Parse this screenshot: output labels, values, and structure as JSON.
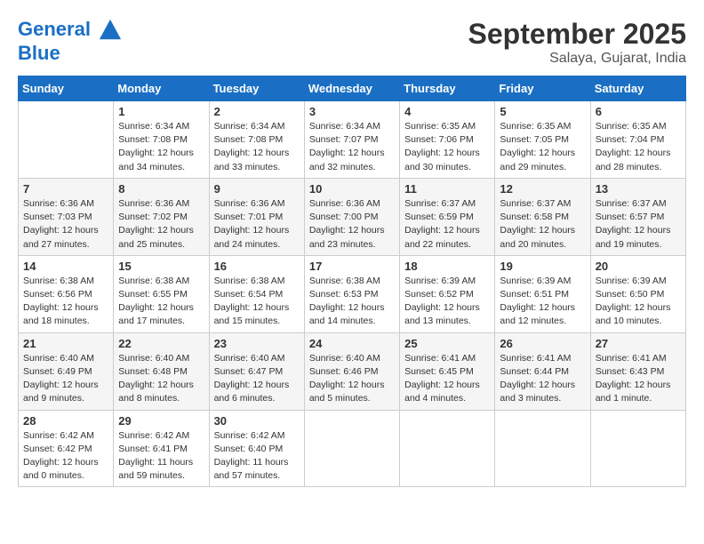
{
  "header": {
    "logo_line1": "General",
    "logo_line2": "Blue",
    "month": "September 2025",
    "location": "Salaya, Gujarat, India"
  },
  "days_of_week": [
    "Sunday",
    "Monday",
    "Tuesday",
    "Wednesday",
    "Thursday",
    "Friday",
    "Saturday"
  ],
  "weeks": [
    [
      {
        "day": "",
        "info": ""
      },
      {
        "day": "1",
        "info": "Sunrise: 6:34 AM\nSunset: 7:08 PM\nDaylight: 12 hours\nand 34 minutes."
      },
      {
        "day": "2",
        "info": "Sunrise: 6:34 AM\nSunset: 7:08 PM\nDaylight: 12 hours\nand 33 minutes."
      },
      {
        "day": "3",
        "info": "Sunrise: 6:34 AM\nSunset: 7:07 PM\nDaylight: 12 hours\nand 32 minutes."
      },
      {
        "day": "4",
        "info": "Sunrise: 6:35 AM\nSunset: 7:06 PM\nDaylight: 12 hours\nand 30 minutes."
      },
      {
        "day": "5",
        "info": "Sunrise: 6:35 AM\nSunset: 7:05 PM\nDaylight: 12 hours\nand 29 minutes."
      },
      {
        "day": "6",
        "info": "Sunrise: 6:35 AM\nSunset: 7:04 PM\nDaylight: 12 hours\nand 28 minutes."
      }
    ],
    [
      {
        "day": "7",
        "info": "Sunrise: 6:36 AM\nSunset: 7:03 PM\nDaylight: 12 hours\nand 27 minutes."
      },
      {
        "day": "8",
        "info": "Sunrise: 6:36 AM\nSunset: 7:02 PM\nDaylight: 12 hours\nand 25 minutes."
      },
      {
        "day": "9",
        "info": "Sunrise: 6:36 AM\nSunset: 7:01 PM\nDaylight: 12 hours\nand 24 minutes."
      },
      {
        "day": "10",
        "info": "Sunrise: 6:36 AM\nSunset: 7:00 PM\nDaylight: 12 hours\nand 23 minutes."
      },
      {
        "day": "11",
        "info": "Sunrise: 6:37 AM\nSunset: 6:59 PM\nDaylight: 12 hours\nand 22 minutes."
      },
      {
        "day": "12",
        "info": "Sunrise: 6:37 AM\nSunset: 6:58 PM\nDaylight: 12 hours\nand 20 minutes."
      },
      {
        "day": "13",
        "info": "Sunrise: 6:37 AM\nSunset: 6:57 PM\nDaylight: 12 hours\nand 19 minutes."
      }
    ],
    [
      {
        "day": "14",
        "info": "Sunrise: 6:38 AM\nSunset: 6:56 PM\nDaylight: 12 hours\nand 18 minutes."
      },
      {
        "day": "15",
        "info": "Sunrise: 6:38 AM\nSunset: 6:55 PM\nDaylight: 12 hours\nand 17 minutes."
      },
      {
        "day": "16",
        "info": "Sunrise: 6:38 AM\nSunset: 6:54 PM\nDaylight: 12 hours\nand 15 minutes."
      },
      {
        "day": "17",
        "info": "Sunrise: 6:38 AM\nSunset: 6:53 PM\nDaylight: 12 hours\nand 14 minutes."
      },
      {
        "day": "18",
        "info": "Sunrise: 6:39 AM\nSunset: 6:52 PM\nDaylight: 12 hours\nand 13 minutes."
      },
      {
        "day": "19",
        "info": "Sunrise: 6:39 AM\nSunset: 6:51 PM\nDaylight: 12 hours\nand 12 minutes."
      },
      {
        "day": "20",
        "info": "Sunrise: 6:39 AM\nSunset: 6:50 PM\nDaylight: 12 hours\nand 10 minutes."
      }
    ],
    [
      {
        "day": "21",
        "info": "Sunrise: 6:40 AM\nSunset: 6:49 PM\nDaylight: 12 hours\nand 9 minutes."
      },
      {
        "day": "22",
        "info": "Sunrise: 6:40 AM\nSunset: 6:48 PM\nDaylight: 12 hours\nand 8 minutes."
      },
      {
        "day": "23",
        "info": "Sunrise: 6:40 AM\nSunset: 6:47 PM\nDaylight: 12 hours\nand 6 minutes."
      },
      {
        "day": "24",
        "info": "Sunrise: 6:40 AM\nSunset: 6:46 PM\nDaylight: 12 hours\nand 5 minutes."
      },
      {
        "day": "25",
        "info": "Sunrise: 6:41 AM\nSunset: 6:45 PM\nDaylight: 12 hours\nand 4 minutes."
      },
      {
        "day": "26",
        "info": "Sunrise: 6:41 AM\nSunset: 6:44 PM\nDaylight: 12 hours\nand 3 minutes."
      },
      {
        "day": "27",
        "info": "Sunrise: 6:41 AM\nSunset: 6:43 PM\nDaylight: 12 hours\nand 1 minute."
      }
    ],
    [
      {
        "day": "28",
        "info": "Sunrise: 6:42 AM\nSunset: 6:42 PM\nDaylight: 12 hours\nand 0 minutes."
      },
      {
        "day": "29",
        "info": "Sunrise: 6:42 AM\nSunset: 6:41 PM\nDaylight: 11 hours\nand 59 minutes."
      },
      {
        "day": "30",
        "info": "Sunrise: 6:42 AM\nSunset: 6:40 PM\nDaylight: 11 hours\nand 57 minutes."
      },
      {
        "day": "",
        "info": ""
      },
      {
        "day": "",
        "info": ""
      },
      {
        "day": "",
        "info": ""
      },
      {
        "day": "",
        "info": ""
      }
    ]
  ]
}
